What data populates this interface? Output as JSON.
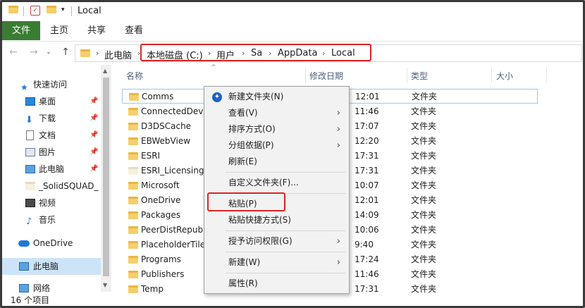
{
  "window": {
    "title": "Local"
  },
  "ribbon": {
    "tabs": [
      "文件",
      "主页",
      "共享",
      "查看"
    ]
  },
  "address": {
    "crumbs": [
      "此电脑",
      "本地磁盘 (C:)",
      "用户",
      "Sa",
      "AppData",
      "Local"
    ]
  },
  "navpane": {
    "items": [
      {
        "label": "快速访问",
        "icon": "star-icon"
      },
      {
        "label": "桌面",
        "icon": "desktop-icon",
        "pinned": true
      },
      {
        "label": "下载",
        "icon": "download-icon",
        "pinned": true
      },
      {
        "label": "文档",
        "icon": "document-icon",
        "pinned": true
      },
      {
        "label": "图片",
        "icon": "pictures-icon",
        "pinned": true
      },
      {
        "label": "此电脑",
        "icon": "computer-icon",
        "pinned": true
      },
      {
        "label": "_SolidSQUAD_",
        "icon": "folder-icon"
      },
      {
        "label": "视频",
        "icon": "video-icon"
      },
      {
        "label": "音乐",
        "icon": "music-icon"
      },
      {
        "label": "OneDrive",
        "icon": "cloud-icon"
      },
      {
        "label": "此电脑",
        "icon": "computer-icon",
        "selected": true
      },
      {
        "label": "网络",
        "icon": "network-icon"
      }
    ]
  },
  "list": {
    "headers": {
      "name": "名称",
      "date": "修改日期",
      "type": "类型",
      "size": "大小"
    },
    "rows": [
      {
        "name": "Comms",
        "date": "12:01",
        "type": "文件夹"
      },
      {
        "name": "ConnectedDevic",
        "date": "11:46",
        "type": "文件夹"
      },
      {
        "name": "D3DSCache",
        "date": "17:07",
        "type": "文件夹"
      },
      {
        "name": "EBWebView",
        "date": "12:20",
        "type": "文件夹"
      },
      {
        "name": "ESRI",
        "date": "17:31",
        "type": "文件夹"
      },
      {
        "name": "ESRI_Licensing",
        "date": "17:31",
        "type": "文件夹"
      },
      {
        "name": "Microsoft",
        "date": "10:07",
        "type": "文件夹"
      },
      {
        "name": "OneDrive",
        "date": "12:01",
        "type": "文件夹"
      },
      {
        "name": "Packages",
        "date": "14:09",
        "type": "文件夹"
      },
      {
        "name": "PeerDistRepub",
        "date": "10:06",
        "type": "文件夹"
      },
      {
        "name": "PlaceholderTile",
        "date": "9:40",
        "type": "文件夹"
      },
      {
        "name": "Programs",
        "date": "17:24",
        "type": "文件夹"
      },
      {
        "name": "Publishers",
        "date": "11:46",
        "type": "文件夹"
      },
      {
        "name": "Temp",
        "date": "17:31",
        "type": "文件夹"
      }
    ]
  },
  "status": {
    "count": "16 个项目"
  },
  "context_menu": {
    "items": [
      {
        "label": "新建文件夹(N)"
      },
      {
        "label": "查看(V)",
        "submenu": true
      },
      {
        "label": "排序方式(O)",
        "submenu": true
      },
      {
        "label": "分组依据(P)",
        "submenu": true
      },
      {
        "label": "刷新(E)"
      },
      {
        "label": "自定义文件夹(F)..."
      },
      {
        "label": "粘贴(P)"
      },
      {
        "label": "粘贴快捷方式(S)"
      },
      {
        "label": "授予访问权限(G)",
        "submenu": true
      },
      {
        "label": "新建(W)",
        "submenu": true
      },
      {
        "label": "属性(R)"
      }
    ]
  },
  "colors": {
    "file_tab": "#3a7d32",
    "highlight_box": "#e02424",
    "selection": "#cce4f7"
  }
}
